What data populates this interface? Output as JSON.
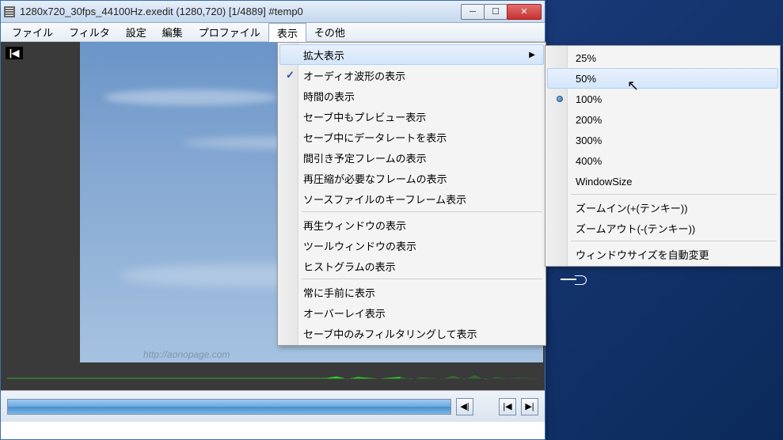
{
  "window": {
    "title": "1280x720_30fps_44100Hz.exedit (1280,720)  [1/4889]  #temp0"
  },
  "menu": {
    "items": [
      "ファイル",
      "フィルタ",
      "設定",
      "編集",
      "プロファイル",
      "表示",
      "その他"
    ],
    "open_index": 5
  },
  "dropdown": {
    "items": [
      {
        "label": "拡大表示",
        "submenu": true,
        "hover": true
      },
      {
        "label": "オーディオ波形の表示",
        "checked": true
      },
      {
        "label": "時間の表示"
      },
      {
        "label": "セーブ中もプレビュー表示"
      },
      {
        "label": "セーブ中にデータレートを表示"
      },
      {
        "label": "間引き予定フレームの表示"
      },
      {
        "label": "再圧縮が必要なフレームの表示"
      },
      {
        "label": "ソースファイルのキーフレーム表示"
      },
      {
        "sep": true
      },
      {
        "label": "再生ウィンドウの表示"
      },
      {
        "label": "ツールウィンドウの表示"
      },
      {
        "label": "ヒストグラムの表示"
      },
      {
        "sep": true
      },
      {
        "label": "常に手前に表示"
      },
      {
        "label": "オーバーレイ表示"
      },
      {
        "label": "セーブ中のみフィルタリングして表示"
      }
    ]
  },
  "submenu": {
    "items": [
      {
        "label": "25%"
      },
      {
        "label": "50%",
        "hover": true
      },
      {
        "label": "100%",
        "radio": true
      },
      {
        "label": "200%"
      },
      {
        "label": "300%"
      },
      {
        "label": "400%"
      },
      {
        "label": "WindowSize"
      },
      {
        "sep": true
      },
      {
        "label": "ズームイン(+(テンキー))"
      },
      {
        "label": "ズームアウト(-(テンキー))"
      },
      {
        "sep": true
      },
      {
        "label": "ウィンドウサイズを自動変更"
      }
    ]
  },
  "watermark": "http://aonopage.com",
  "controls": {
    "prev_marker": "◂|",
    "next_start": "|◂",
    "next_end": "▸|"
  }
}
